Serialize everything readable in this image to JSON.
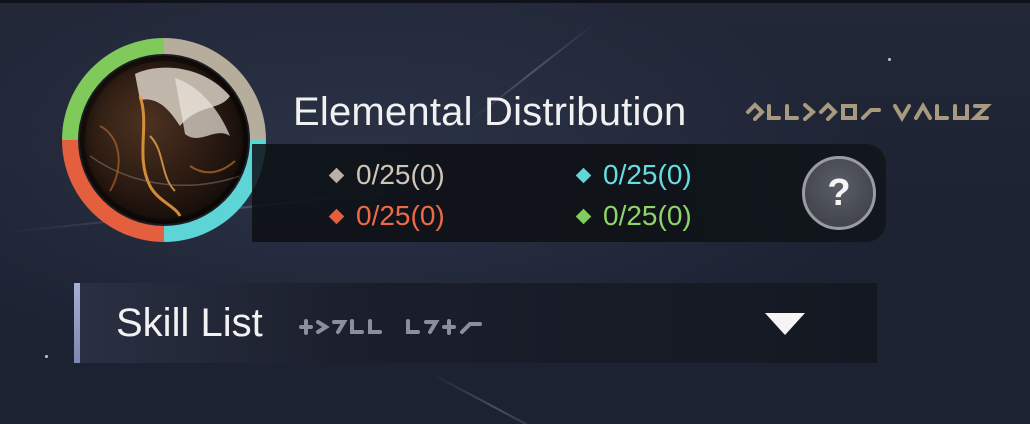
{
  "panel": {
    "title": "Elemental Distribution",
    "help_label": "?"
  },
  "stats": [
    {
      "element": "neutral",
      "value": "0/25(0)",
      "color": "#cfc6b8",
      "diamond_color": "#b8b0a2"
    },
    {
      "element": "ice",
      "value": "0/25(0)",
      "color": "#66dde0",
      "diamond_color": "#5fd6d8"
    },
    {
      "element": "fire",
      "value": "0/25(0)",
      "color": "#ee6a45",
      "diamond_color": "#e85e3c"
    },
    {
      "element": "nature",
      "value": "0/25(0)",
      "color": "#8fd468",
      "diamond_color": "#82cb5c"
    }
  ],
  "skill_list": {
    "label": "Skill List"
  },
  "colors": {
    "ring_neutral": "#b6ad9d",
    "ring_ice": "#5dd4d6",
    "ring_fire": "#e35f3d",
    "ring_nature": "#80c95b",
    "glyph": "#a89a7f"
  },
  "icons": {
    "orb": "element-orb-icon",
    "help": "question-mark-icon",
    "dropdown": "triangle-down-icon"
  }
}
